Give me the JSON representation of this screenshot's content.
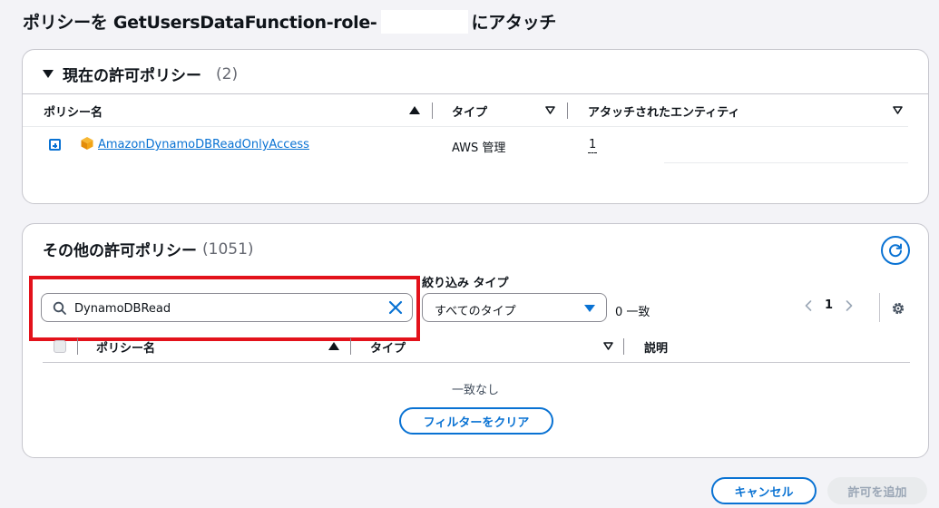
{
  "page": {
    "title_prefix": "ポリシーを GetUsersDataFunction-role-",
    "title_suffix": "にアタッチ"
  },
  "current_policies": {
    "title": "現在の許可ポリシー",
    "count": "(2)",
    "columns": {
      "name": "ポリシー名",
      "type": "タイプ",
      "entities": "アタッチされたエンティティ"
    },
    "rows": [
      {
        "name": "AmazonDynamoDBReadOnlyAccess",
        "type": "AWS 管理",
        "entities": "1"
      }
    ]
  },
  "other_policies": {
    "title": "その他の許可ポリシー",
    "count": "(1051)",
    "search": {
      "value": "DynamoDBRead"
    },
    "filter": {
      "label": "絞り込み タイプ",
      "selected": "すべてのタイプ"
    },
    "match_count": "0 一致",
    "pagination": {
      "current_page": "1"
    },
    "columns": {
      "name": "ポリシー名",
      "type": "タイプ",
      "description": "説明"
    },
    "empty_text": "一致なし",
    "clear_filter_label": "フィルターをクリア"
  },
  "footer": {
    "cancel_label": "キャンセル",
    "add_label": "許可を追加"
  },
  "colors": {
    "accent": "#0972d3",
    "highlight_box": "#e3121b",
    "icon_orange": "#f2a416"
  }
}
